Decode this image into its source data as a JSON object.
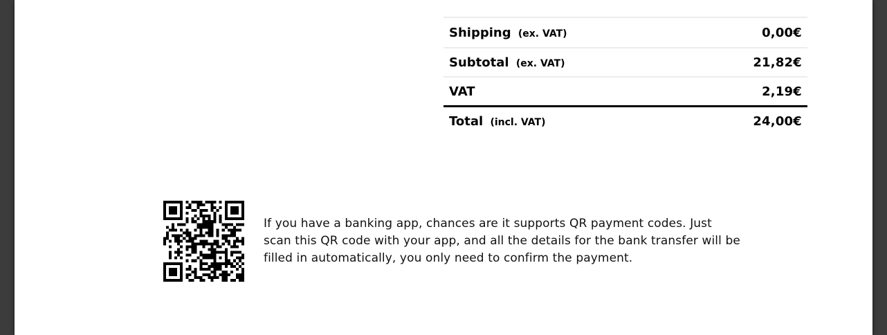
{
  "totals": {
    "rows": [
      {
        "label": "Shipping",
        "note": "(ex. VAT)",
        "amount": "0,00€"
      },
      {
        "label": "Subtotal",
        "note": "(ex. VAT)",
        "amount": "21,82€"
      },
      {
        "label": "VAT",
        "note": "",
        "amount": "2,19€"
      },
      {
        "label": "Total",
        "note": "(incl. VAT)",
        "amount": "24,00€"
      }
    ]
  },
  "payment": {
    "qr_description": "If you have a banking app, chances are it supports QR payment codes. Just scan this QR code with your app, and all the details for the bank transfer will be filled in automatically, you only need to confirm the payment.",
    "qr_icon": "qr-code-icon"
  },
  "colors": {
    "page": "#ffffff",
    "viewer_background": "#3c3c3c",
    "row_divider": "#ececec",
    "total_divider": "#000000"
  }
}
